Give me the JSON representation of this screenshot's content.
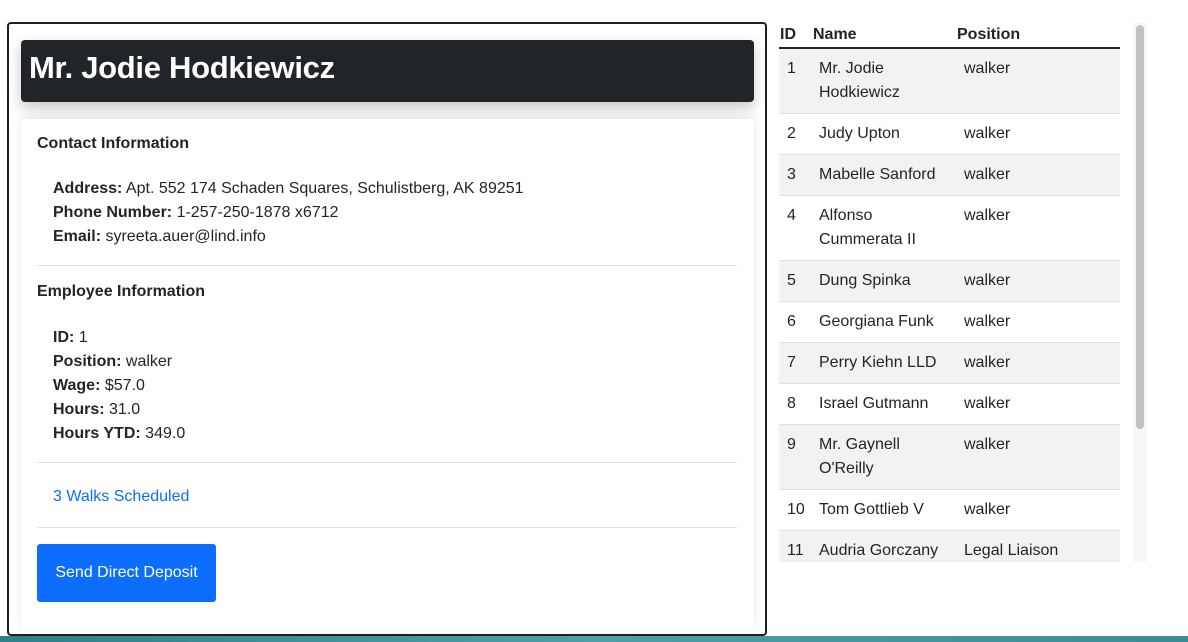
{
  "employee": {
    "name": "Mr. Jodie Hodkiewicz",
    "contact_section_title": "Contact Information",
    "address_label": "Address:",
    "address": "Apt. 552 174 Schaden Squares, Schulistberg, AK 89251",
    "phone_label": "Phone Number:",
    "phone": "1-257-250-1878 x6712",
    "email_label": "Email:",
    "email": "syreeta.auer@lind.info",
    "employee_section_title": "Employee Information",
    "id_label": "ID:",
    "id": "1",
    "position_label": "Position:",
    "position": "walker",
    "wage_label": "Wage:",
    "wage": "$57.0",
    "hours_label": "Hours:",
    "hours": "31.0",
    "hours_ytd_label": "Hours YTD:",
    "hours_ytd": "349.0",
    "walks_link": "3 Walks Scheduled",
    "deposit_button": "Send Direct Deposit"
  },
  "table": {
    "headers": {
      "id": "ID",
      "name": "Name",
      "position": "Position"
    },
    "rows": [
      {
        "id": "1",
        "name": "Mr. Jodie Hodkiewicz",
        "position": "walker"
      },
      {
        "id": "2",
        "name": "Judy Upton",
        "position": "walker"
      },
      {
        "id": "3",
        "name": "Mabelle Sanford",
        "position": "walker"
      },
      {
        "id": "4",
        "name": "Alfonso Cummerata II",
        "position": "walker"
      },
      {
        "id": "5",
        "name": "Dung Spinka",
        "position": "walker"
      },
      {
        "id": "6",
        "name": "Georgiana Funk",
        "position": "walker"
      },
      {
        "id": "7",
        "name": "Perry Kiehn LLD",
        "position": "walker"
      },
      {
        "id": "8",
        "name": "Israel Gutmann",
        "position": "walker"
      },
      {
        "id": "9",
        "name": "Mr. Gaynell O'Reilly",
        "position": "walker"
      },
      {
        "id": "10",
        "name": "Tom Gottlieb V",
        "position": "walker"
      },
      {
        "id": "11",
        "name": "Audria Gorczany",
        "position": "Legal Liaison"
      }
    ]
  },
  "colors": {
    "header_bg": "#212529",
    "accent": "#0d6efd",
    "stripe": "#f2f2f2"
  }
}
